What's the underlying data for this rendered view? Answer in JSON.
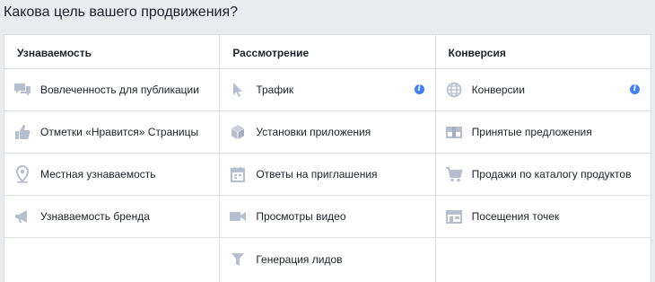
{
  "page": {
    "title": "Какова цель вашего продвижения?"
  },
  "columns": [
    {
      "header": "Узнаваемость",
      "items": [
        {
          "label": "Вовлеченность для публикации",
          "icon": "chat-bubbles-icon"
        },
        {
          "label": "Отметки «Нравится» Страницы",
          "icon": "thumbs-up-icon"
        },
        {
          "label": "Местная узнаваемость",
          "icon": "map-pin-icon"
        },
        {
          "label": "Узнаваемость бренда",
          "icon": "megaphone-icon"
        }
      ]
    },
    {
      "header": "Рассмотрение",
      "items": [
        {
          "label": "Трафик",
          "icon": "cursor-icon",
          "info": "i"
        },
        {
          "label": "Установки приложения",
          "icon": "box-icon"
        },
        {
          "label": "Ответы на приглашения",
          "icon": "calendar-icon"
        },
        {
          "label": "Просмотры видео",
          "icon": "video-camera-icon"
        },
        {
          "label": "Генерация лидов",
          "icon": "funnel-icon"
        }
      ]
    },
    {
      "header": "Конверсия",
      "items": [
        {
          "label": "Конверсии",
          "icon": "globe-icon",
          "info": "i"
        },
        {
          "label": "Принятые предложения",
          "icon": "offer-tag-icon"
        },
        {
          "label": "Продажи по каталогу продуктов",
          "icon": "shopping-cart-icon"
        },
        {
          "label": "Посещения точек",
          "icon": "store-icon"
        }
      ]
    }
  ],
  "colors": {
    "icon": "#b6bfd0",
    "info": "#4080ff",
    "border": "#dddfe2",
    "background": "#e9ebee"
  }
}
